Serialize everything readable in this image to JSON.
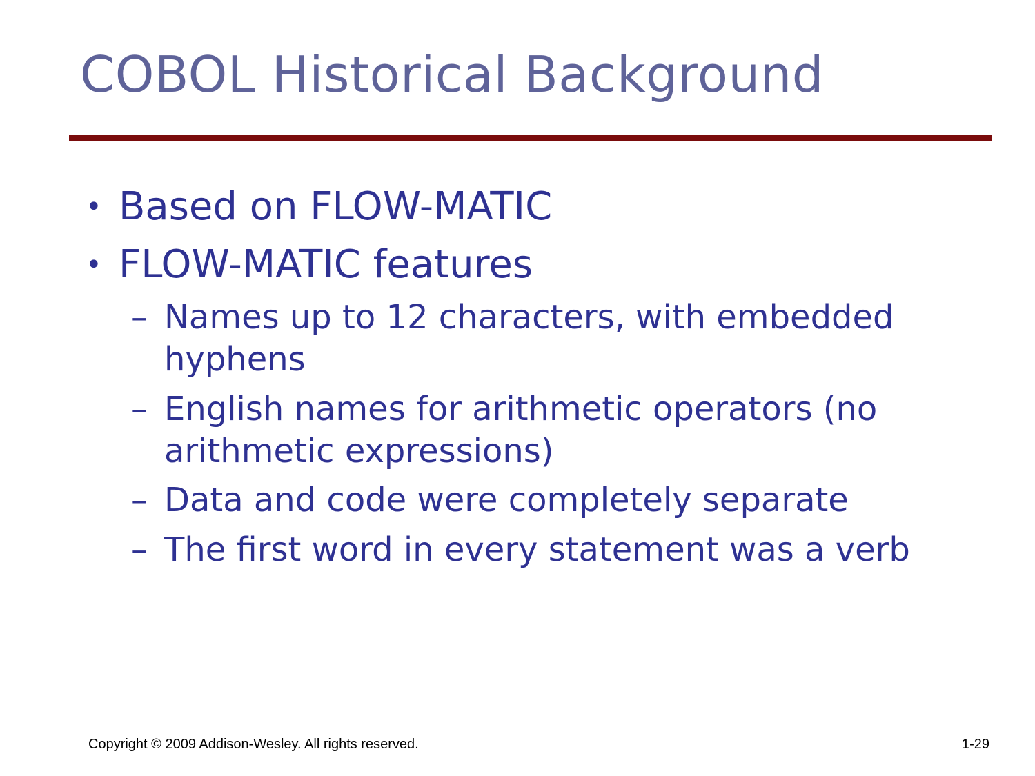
{
  "slide": {
    "title": "COBOL Historical Background",
    "bullets": [
      {
        "text": "Based on FLOW-MATIC"
      },
      {
        "text": "FLOW-MATIC features"
      }
    ],
    "sub_bullets": [
      {
        "text": "Names up to 12 characters, with embedded hyphens"
      },
      {
        "text": "English names for arithmetic operators (no arithmetic expressions)"
      },
      {
        "text": "Data and code were completely separate"
      },
      {
        "text": "The first word in every statement was a verb"
      }
    ],
    "bullet_marker": "•",
    "sub_bullet_marker": "–",
    "footer": {
      "copyright": "Copyright © 2009 Addison-Wesley. All rights reserved.",
      "page_number": "1-29"
    },
    "colors": {
      "title": "#5f6399",
      "rule": "#7a0c0c",
      "body_text": "#2e3192"
    }
  }
}
